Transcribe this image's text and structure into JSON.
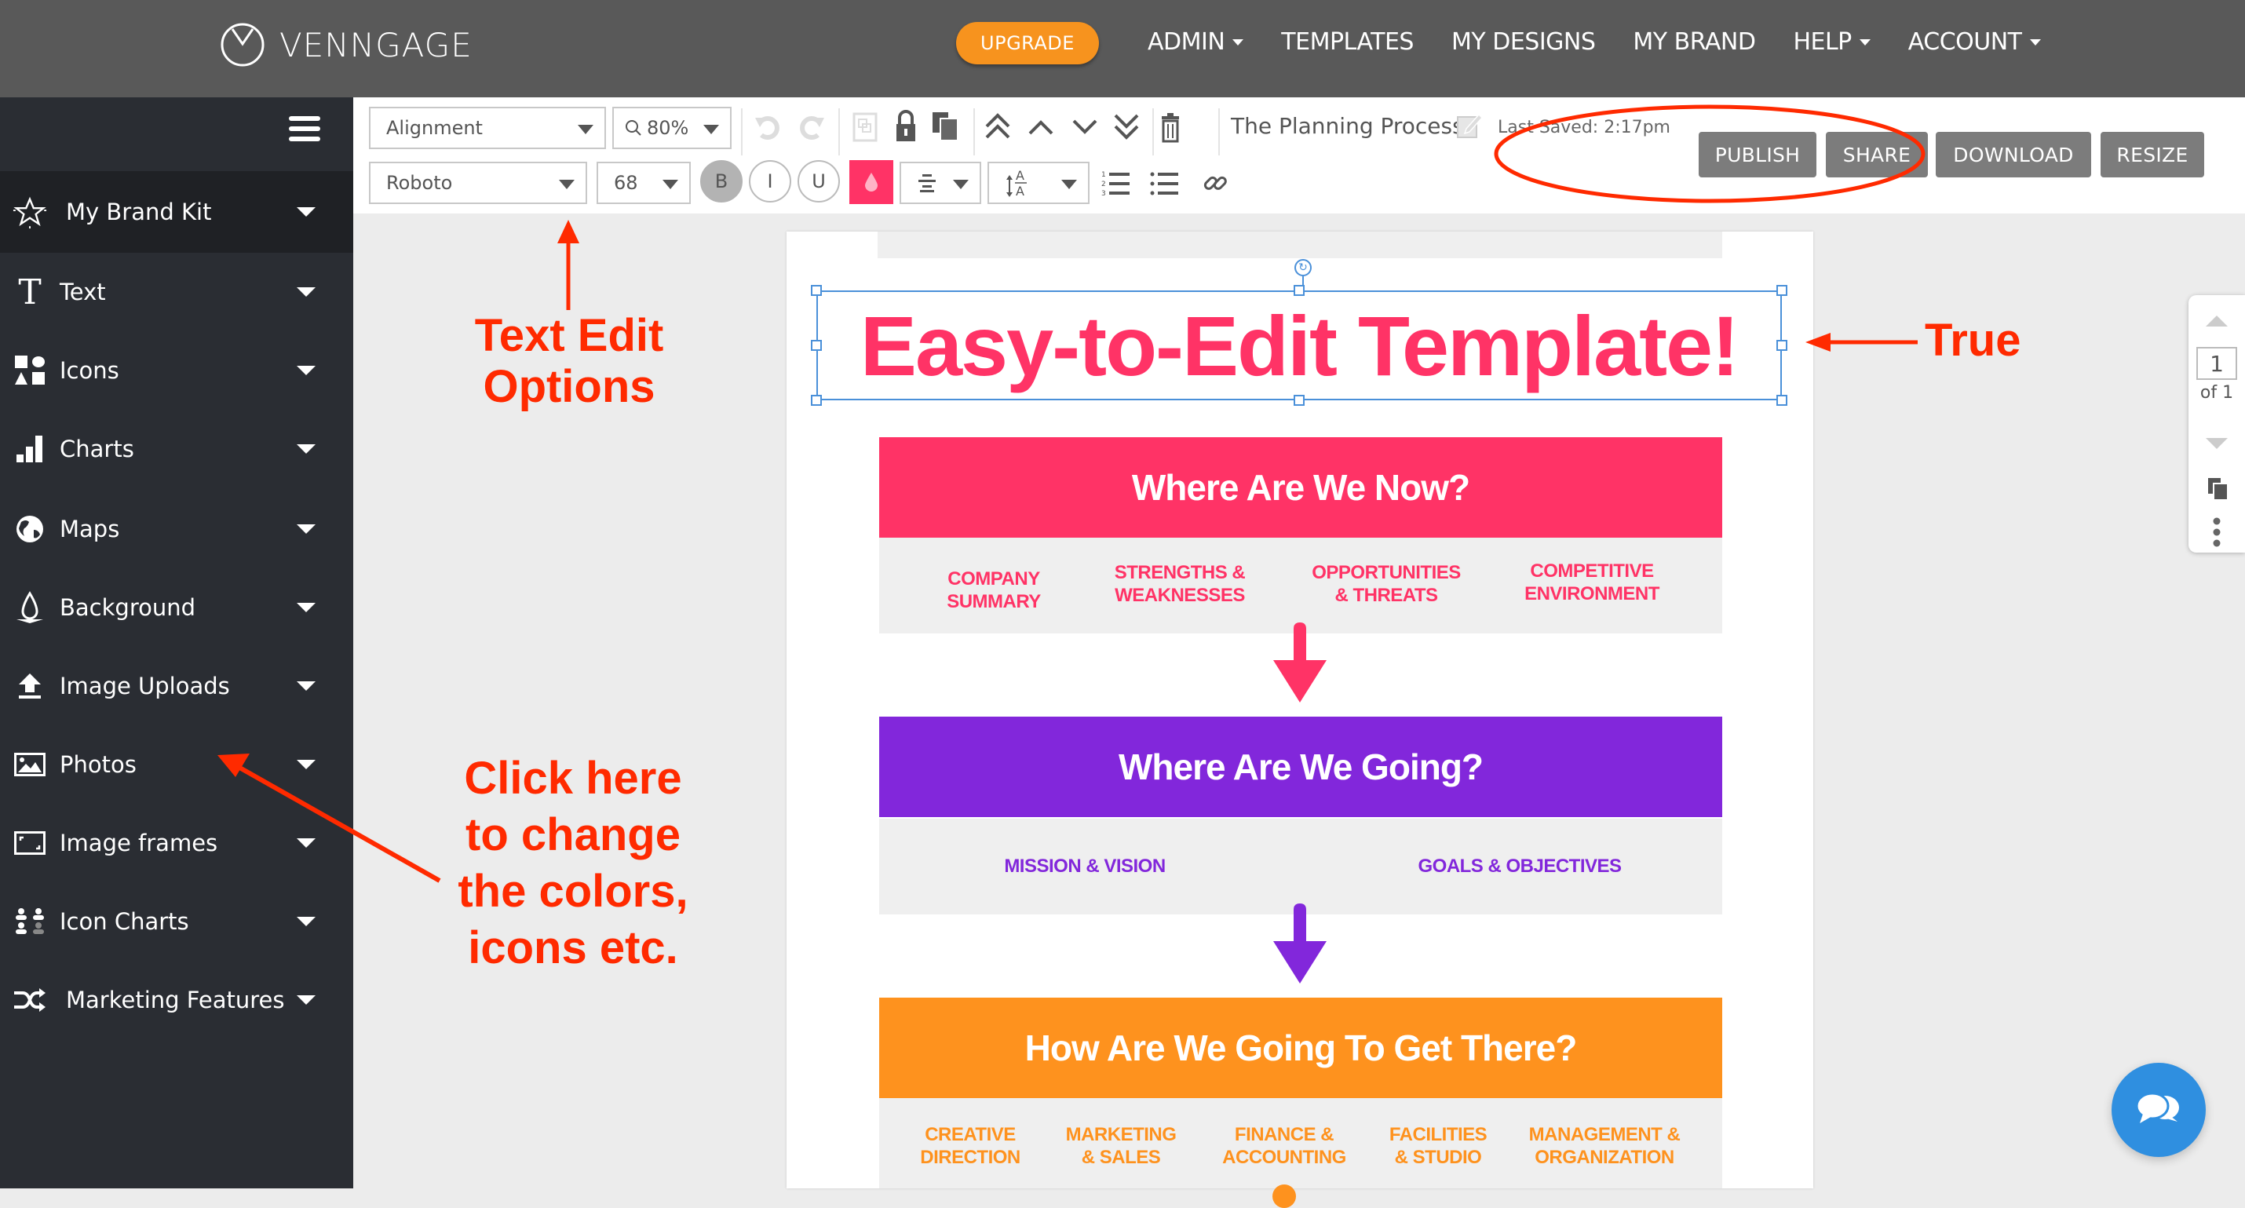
{
  "header": {
    "brand": "VENNGAGE",
    "upgrade_label": "UPGRADE",
    "nav": [
      {
        "label": "ADMIN",
        "has_dropdown": true
      },
      {
        "label": "TEMPLATES",
        "has_dropdown": false
      },
      {
        "label": "MY DESIGNS",
        "has_dropdown": false
      },
      {
        "label": "MY BRAND",
        "has_dropdown": false
      },
      {
        "label": "HELP",
        "has_dropdown": true
      },
      {
        "label": "ACCOUNT",
        "has_dropdown": true
      }
    ]
  },
  "sidebar": {
    "items": [
      {
        "label": "My Brand Kit",
        "icon": "star-icon",
        "active": true
      },
      {
        "label": "Text",
        "icon": "text-icon"
      },
      {
        "label": "Icons",
        "icon": "shapes-icon"
      },
      {
        "label": "Charts",
        "icon": "bar-chart-icon"
      },
      {
        "label": "Maps",
        "icon": "globe-icon"
      },
      {
        "label": "Background",
        "icon": "drop-icon"
      },
      {
        "label": "Image Uploads",
        "icon": "upload-icon"
      },
      {
        "label": "Photos",
        "icon": "photo-icon"
      },
      {
        "label": "Image frames",
        "icon": "frame-icon"
      },
      {
        "label": "Icon Charts",
        "icon": "people-icon"
      },
      {
        "label": "Marketing Features",
        "icon": "shuffle-icon"
      }
    ]
  },
  "toolbar": {
    "alignment_label": "Alignment",
    "zoom_value": "80%",
    "font_family": "Roboto",
    "font_size": "68",
    "bold_label": "B",
    "italic_label": "I",
    "underline_label": "U",
    "text_color": "#ff3366",
    "document_title": "The Planning Process",
    "last_saved": "Last Saved: 2:17pm",
    "actions": [
      "PUBLISH",
      "SHARE",
      "DOWNLOAD",
      "RESIZE"
    ]
  },
  "canvas": {
    "title": "Easy-to-Edit Template!",
    "sections": [
      {
        "heading": "Where Are We Now?",
        "color": "#ff3366",
        "items": [
          [
            "COMPANY",
            "SUMMARY"
          ],
          [
            "STRENGTHS &",
            "WEAKNESSES"
          ],
          [
            "OPPORTUNITIES",
            "& THREATS"
          ],
          [
            "COMPETITIVE",
            "ENVIRONMENT"
          ]
        ]
      },
      {
        "heading": "Where Are We Going?",
        "color": "#8227db",
        "items": [
          [
            "MISSION & VISION"
          ],
          [
            "GOALS & OBJECTIVES"
          ]
        ]
      },
      {
        "heading": "How Are We Going To Get There?",
        "color": "#fe921e",
        "items": [
          [
            "CREATIVE",
            "DIRECTION"
          ],
          [
            "MARKETING",
            "& SALES"
          ],
          [
            "FINANCE &",
            "ACCOUNTING"
          ],
          [
            "FACILITIES",
            "& STUDIO"
          ],
          [
            "MANAGEMENT &",
            "ORGANIZATION"
          ]
        ]
      }
    ]
  },
  "page_nav": {
    "current": "1",
    "total_label": "of 1"
  },
  "annotations": {
    "text_edit": [
      "Text Edit",
      "Options"
    ],
    "true_label": "True",
    "click_here": [
      "Click here",
      "to change",
      "the colors,",
      "icons etc."
    ],
    "color": "#ff2a00"
  }
}
